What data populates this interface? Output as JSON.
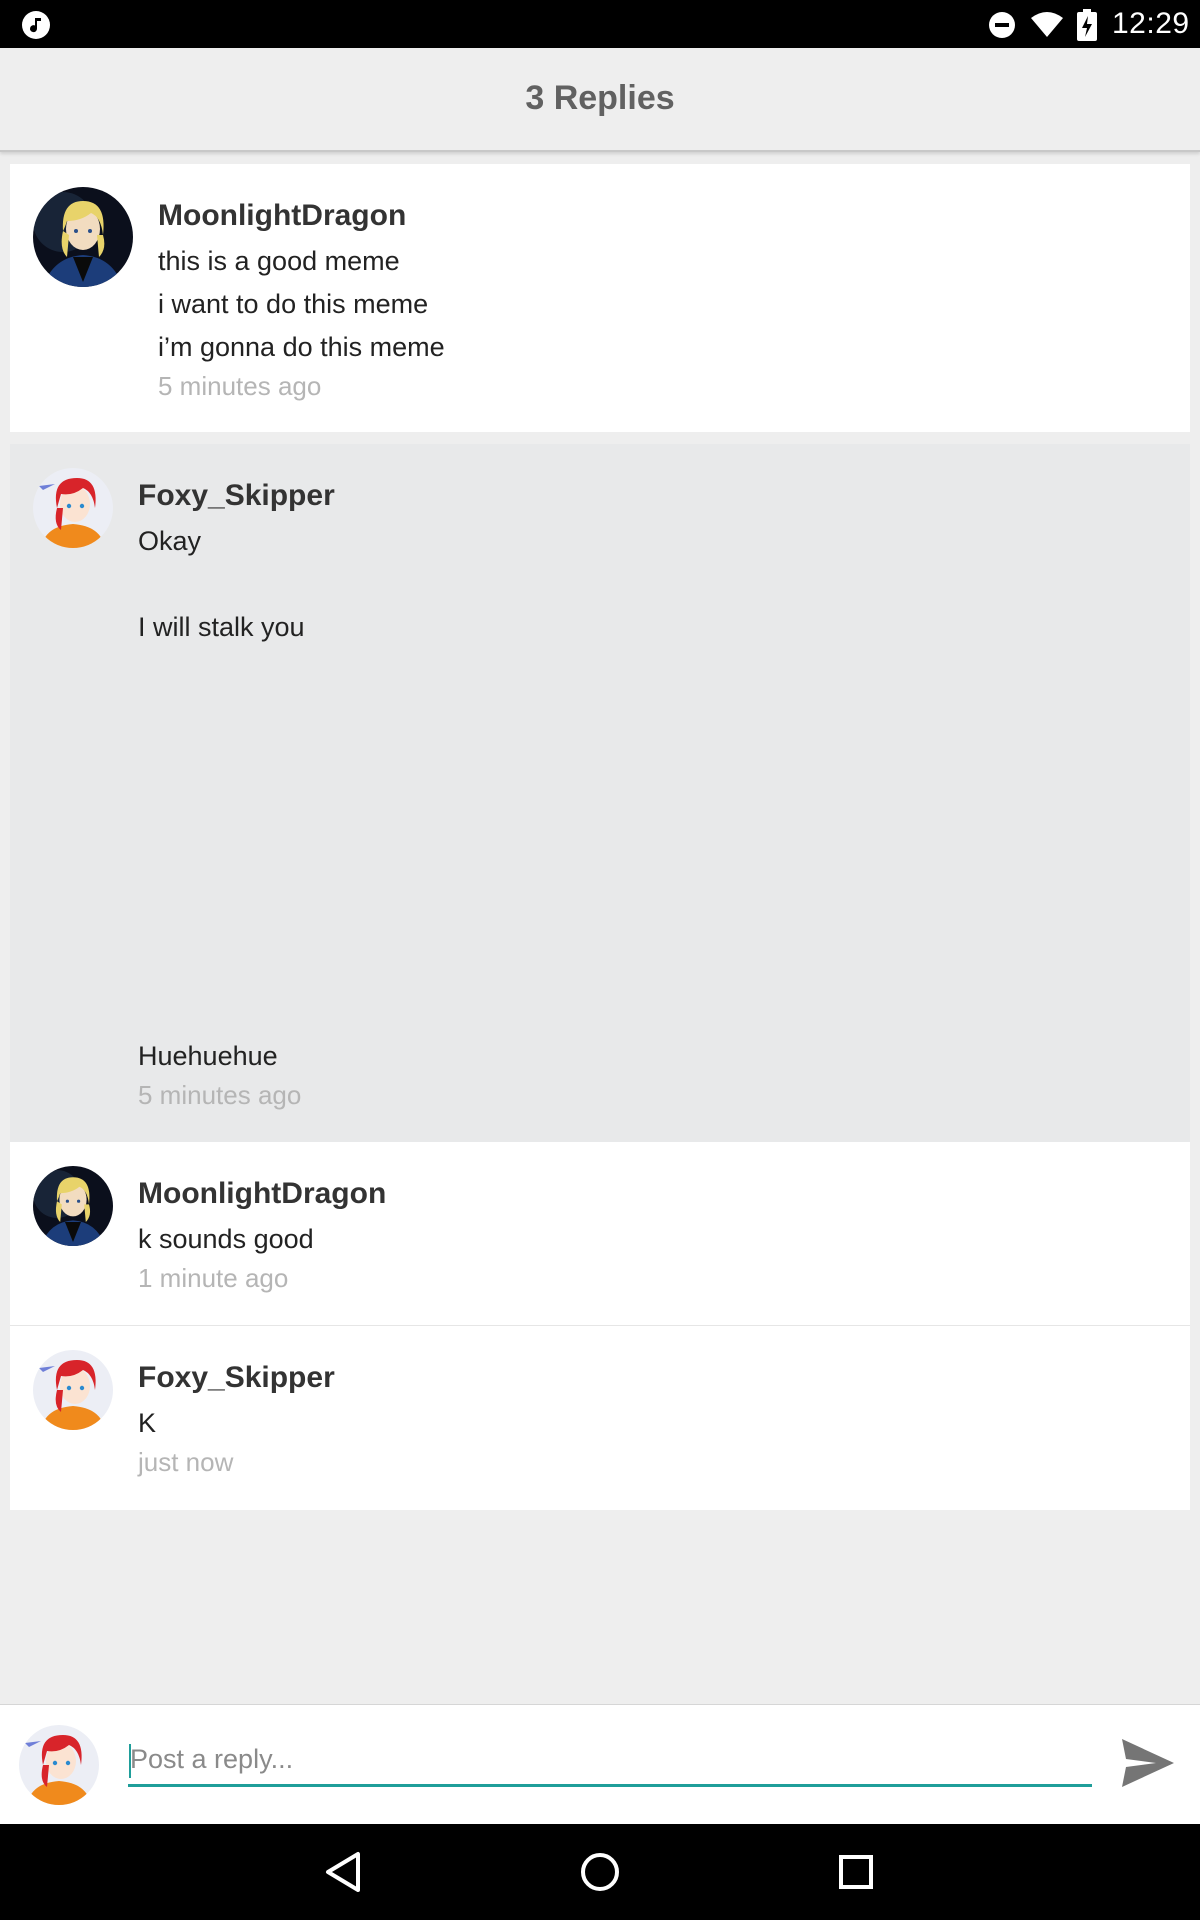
{
  "status_bar": {
    "time": "12:29",
    "icons": [
      "music-note-icon",
      "do-not-disturb-icon",
      "wifi-icon",
      "battery-charging-icon"
    ]
  },
  "header": {
    "title": "3 Replies"
  },
  "replies": [
    {
      "username": "MoonlightDragon",
      "avatar": "moonlight-dragon-avatar",
      "lines": [
        "this is a good meme",
        "i want to do this meme",
        "i’m gonna do this meme"
      ],
      "time": "5 minutes ago",
      "highlighted": false
    },
    {
      "username": "Foxy_Skipper",
      "avatar": "foxy-skipper-avatar",
      "lines": [
        "Okay",
        "I will stalk you",
        "Huehuehue"
      ],
      "time": "5 minutes ago",
      "highlighted": true
    },
    {
      "username": "MoonlightDragon",
      "avatar": "moonlight-dragon-avatar",
      "lines": [
        "k sounds good"
      ],
      "time": "1 minute ago",
      "highlighted": false
    },
    {
      "username": "Foxy_Skipper",
      "avatar": "foxy-skipper-avatar",
      "lines": [
        "K"
      ],
      "time": "just now",
      "highlighted": false
    }
  ],
  "composer": {
    "placeholder": "Post a reply...",
    "value": "",
    "send_icon": "send-icon",
    "accent_color": "#1f9e9a"
  },
  "nav_bar": {
    "icons": [
      "back-icon",
      "home-icon",
      "recent-apps-icon"
    ]
  },
  "colors": {
    "background": "#eeeeee",
    "card": "#ffffff",
    "highlight_card": "#e8e9ea",
    "timestamp": "#b5b5b5"
  }
}
